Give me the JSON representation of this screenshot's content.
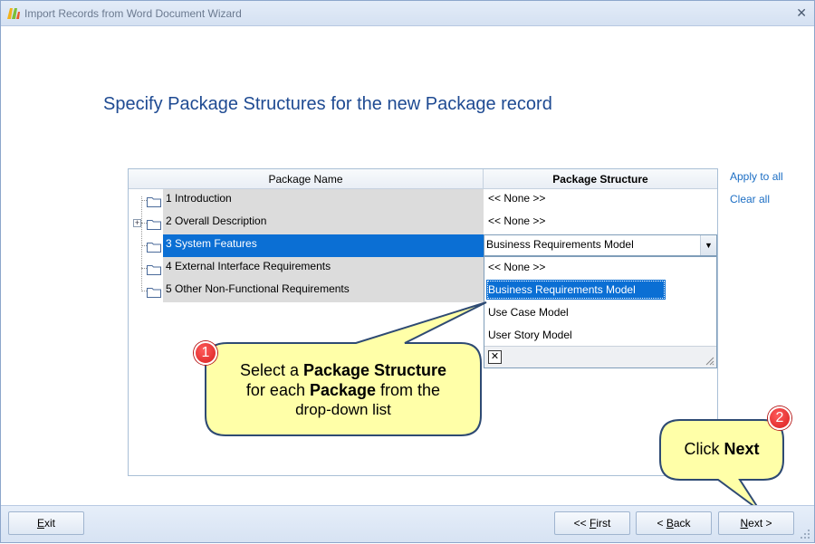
{
  "window": {
    "title": "Import Records from Word Document Wizard",
    "close_icon": "close-icon"
  },
  "page_title": "Specify Package Structures for the new Package record",
  "grid": {
    "columns": [
      "Package Name",
      "Package Structure"
    ],
    "rows": [
      {
        "name": "1 Introduction",
        "structure": "<< None >>"
      },
      {
        "name": "2 Overall Description",
        "structure": "<< None >>"
      },
      {
        "name": "3 System Features",
        "structure": "Business Requirements Model"
      },
      {
        "name": "4 External Interface Requirements",
        "structure": ""
      },
      {
        "name": "5 Other Non-Functional Requirements",
        "structure": ""
      }
    ],
    "combo_value": "Business Requirements Model",
    "dropdown_options": [
      "<< None >>",
      "Business Requirements Model",
      "Use Case Model",
      "User Story Model"
    ],
    "dropdown_selected": "Business Requirements Model"
  },
  "links": {
    "apply_all": "Apply to all",
    "clear_all": "Clear all"
  },
  "callouts": {
    "c1": {
      "badge": "1",
      "line1_pre": "Select a ",
      "line1_bold": "Package Structure",
      "line2_pre": "for each ",
      "line2_bold": "Package",
      "line2_post": " from the",
      "line3": "drop-down list"
    },
    "c2": {
      "badge": "2",
      "pre": "Click ",
      "bold": "Next"
    }
  },
  "buttons": {
    "exit_u": "E",
    "exit_rest": "xit",
    "first_pre": "<< ",
    "first_u": "F",
    "first_rest": "irst",
    "back_pre": "< ",
    "back_u": "B",
    "back_rest": "ack",
    "next_u": "N",
    "next_rest": "ext >"
  },
  "colors": {
    "accent": "#0b6fd4",
    "title": "#1e4a92",
    "callout_fill": "#ffffa8",
    "callout_stroke": "#2e4a73",
    "badge": "#d81e1e"
  }
}
